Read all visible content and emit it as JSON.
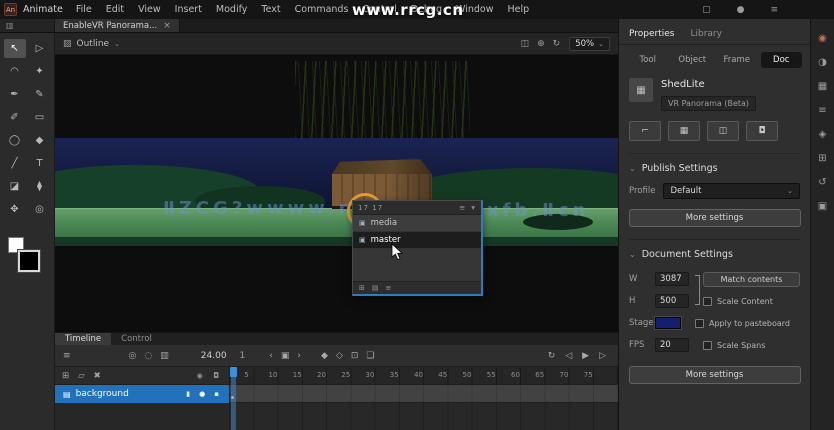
{
  "ui": {
    "chevron": "⌄"
  },
  "menu": {
    "app_icon_text": "An",
    "app_label": "Animate",
    "items": [
      "File",
      "Edit",
      "View",
      "Insert",
      "Modify",
      "Text",
      "Commands",
      "Control",
      "Debug",
      "Window",
      "Help"
    ],
    "watermark": "www.rrcg.cn",
    "right_icons": [
      {
        "name": "workspace-icon",
        "glyph": "▢"
      },
      {
        "name": "search-icon",
        "glyph": "●"
      },
      {
        "name": "app-menu-icon",
        "glyph": "≡"
      }
    ]
  },
  "doc_tab": {
    "panel_icon": "▥",
    "title": "EnableVR Panorama...",
    "close": "×"
  },
  "edit_bar": {
    "breadcrumb_icon": "▨",
    "breadcrumb": "Outline",
    "right_icons": [
      {
        "name": "camera-icon",
        "glyph": "◫"
      },
      {
        "name": "center-stage-icon",
        "glyph": "⊕"
      },
      {
        "name": "rotate-view-icon",
        "glyph": "↻"
      }
    ],
    "zoom": "50%"
  },
  "tools": {
    "fill_swatch": "#ffffff",
    "stroke_swatch": "#000000",
    "items": [
      {
        "name": "selection-tool",
        "glyph": "↖",
        "active": true
      },
      {
        "name": "subselection-tool",
        "glyph": "▷"
      },
      {
        "name": "lasso-tool",
        "glyph": "◠"
      },
      {
        "name": "magic-wand-tool",
        "glyph": "✦"
      },
      {
        "name": "pen-tool",
        "glyph": "✒"
      },
      {
        "name": "pencil-tool",
        "glyph": "✎"
      },
      {
        "name": "brush-tool",
        "glyph": "✐"
      },
      {
        "name": "rectangle-tool",
        "glyph": "▭"
      },
      {
        "name": "oval-tool",
        "glyph": "◯"
      },
      {
        "name": "paint-bucket-tool",
        "glyph": "◆"
      },
      {
        "name": "line-tool",
        "glyph": "╱"
      },
      {
        "name": "text-tool",
        "glyph": "T"
      },
      {
        "name": "eraser-tool",
        "glyph": "◪"
      },
      {
        "name": "eyedropper-tool",
        "glyph": "⧫"
      },
      {
        "name": "hand-tool",
        "glyph": "✥"
      },
      {
        "name": "zoom-tool",
        "glyph": "◎"
      }
    ]
  },
  "stage": {
    "watermark_left": "ⅡZCG?wwww.rr",
    "watermark_right": "xfb.Ⅱcn"
  },
  "popup": {
    "header_value": "17 17",
    "menu_icons": [
      {
        "name": "popup-list-icon",
        "glyph": "≡"
      },
      {
        "name": "popup-dropdown-icon",
        "glyph": "▾"
      }
    ],
    "items": [
      {
        "icon": "▣",
        "label": "media",
        "selected": false
      },
      {
        "icon": "▣",
        "label": "master",
        "selected": true
      }
    ],
    "footer_icons": [
      {
        "name": "new-symbol-icon",
        "glyph": "⊞"
      },
      {
        "name": "new-folder-icon",
        "glyph": "▤"
      },
      {
        "name": "item-properties-icon",
        "glyph": "≡"
      }
    ]
  },
  "timeline": {
    "tabs": [
      {
        "label": "Timeline",
        "active": true
      },
      {
        "label": "Control",
        "active": false
      }
    ],
    "toolbar": {
      "layers_icon": "≡",
      "group_onion": [
        {
          "name": "onion-skin-icon",
          "glyph": "◎"
        },
        {
          "name": "onion-outlines-icon",
          "glyph": "◌"
        },
        {
          "name": "edit-multiple-frames-icon",
          "glyph": "▥"
        }
      ],
      "fps_value": "24.00",
      "frame_value": "1",
      "group_nav": [
        {
          "name": "step-back-icon",
          "glyph": "‹"
        },
        {
          "name": "current-frame-icon",
          "glyph": "▣"
        },
        {
          "name": "step-forward-icon",
          "glyph": "›"
        }
      ],
      "group_mark": [
        {
          "name": "insert-keyframe-icon",
          "glyph": "◆"
        },
        {
          "name": "insert-blank-keyframe-icon",
          "glyph": "◇"
        },
        {
          "name": "frame-view-icon",
          "glyph": "⊡"
        },
        {
          "name": "frame-label-icon",
          "glyph": "❏"
        }
      ],
      "group_play": [
        {
          "name": "loop-icon",
          "glyph": "↻"
        },
        {
          "name": "prev-frame-icon",
          "glyph": "◁"
        },
        {
          "name": "play-icon",
          "glyph": "▶"
        },
        {
          "name": "next-frame-icon",
          "glyph": "▷"
        }
      ]
    },
    "layer_buttons": [
      {
        "name": "new-layer-icon",
        "glyph": "⊞"
      },
      {
        "name": "new-folder-icon",
        "glyph": "▱"
      },
      {
        "name": "delete-layer-icon",
        "glyph": "✖"
      }
    ],
    "column_icons": [
      {
        "name": "show-hide-column-icon",
        "glyph": "◉"
      },
      {
        "name": "lock-column-icon",
        "glyph": "◘"
      }
    ],
    "ruler": [
      5,
      10,
      15,
      20,
      25,
      30,
      35,
      40,
      45,
      50,
      55,
      60,
      65,
      70,
      75
    ],
    "layers": [
      {
        "name": "background",
        "icon": "▤",
        "selected": true,
        "status_icons": [
          {
            "name": "layer-highlight-toggle",
            "glyph": "▮"
          },
          {
            "name": "layer-visibility-dot",
            "glyph": "●"
          },
          {
            "name": "layer-lock-dot",
            "glyph": "▪"
          }
        ]
      }
    ]
  },
  "properties": {
    "panel_tabs": [
      {
        "label": "Properties",
        "active": true
      },
      {
        "label": "Library",
        "active": false
      }
    ],
    "sub_tabs": [
      {
        "label": "Tool",
        "active": false
      },
      {
        "label": "Object",
        "active": false
      },
      {
        "label": "Frame",
        "active": false
      },
      {
        "label": "Doc",
        "active": true
      }
    ],
    "doc_icon": "▦",
    "doc_name": "ShedLite",
    "doc_type": "VR Panorama (Beta)",
    "quick_buttons": [
      {
        "name": "pin-view-icon",
        "glyph": "⌐"
      },
      {
        "name": "grid-icon",
        "glyph": "▦"
      },
      {
        "name": "guides-icon",
        "glyph": "◫"
      },
      {
        "name": "snap-icon",
        "glyph": "◘"
      }
    ],
    "publish": {
      "title": "Publish Settings",
      "profile_label": "Profile",
      "profile_value": "Default",
      "more_label": "More settings"
    },
    "doc_settings": {
      "title": "Document Settings",
      "w_label": "W",
      "w_value": "3087",
      "h_label": "H",
      "h_value": "500",
      "stage_label": "Stage",
      "stage_color": "#141f6e",
      "fps_label": "FPS",
      "fps_value": "20",
      "match_label": "Match contents",
      "checks": [
        {
          "label": "Scale Content",
          "checked": false
        },
        {
          "label": "Apply to pasteboard",
          "checked": false
        },
        {
          "label": "Scale Spans",
          "checked": false
        }
      ],
      "more_label": "More settings"
    }
  },
  "dock": [
    {
      "name": "cc-libraries-icon",
      "glyph": "◉",
      "accent": true
    },
    {
      "name": "color-panel-icon",
      "glyph": "◑"
    },
    {
      "name": "swatches-panel-icon",
      "glyph": "▦"
    },
    {
      "name": "align-panel-icon",
      "glyph": "≡"
    },
    {
      "name": "info-panel-icon",
      "glyph": "◈"
    },
    {
      "name": "transform-panel-icon",
      "glyph": "⊞"
    },
    {
      "name": "history-panel-icon",
      "glyph": "↺"
    },
    {
      "name": "components-panel-icon",
      "glyph": "▣"
    }
  ]
}
